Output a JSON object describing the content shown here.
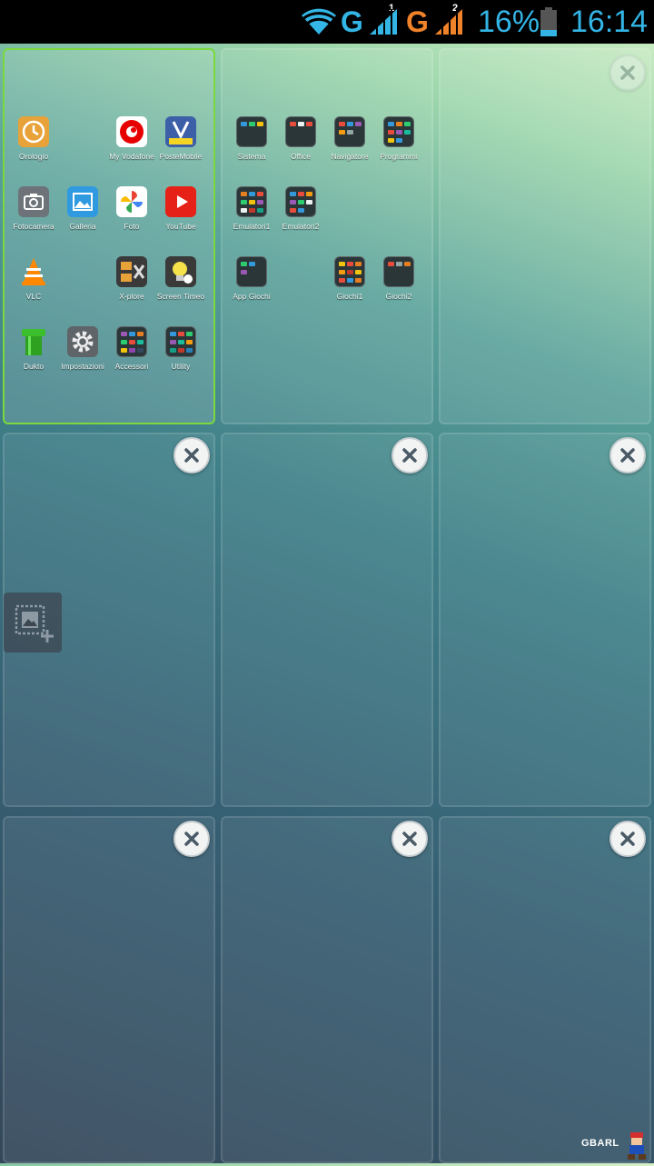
{
  "status_bar": {
    "network_1": "G",
    "sim_1": "1",
    "network_2": "G",
    "sim_2": "2",
    "battery": "16%",
    "time": "16:14",
    "colors": {
      "accent": "#33b5e5",
      "signal_2": "#f0822a",
      "background": "#000000"
    },
    "icons": [
      "wifi-icon",
      "signal-icon",
      "signal-icon",
      "battery-icon"
    ]
  },
  "screens": {
    "screen_1": {
      "active": true,
      "apps": [
        {
          "label": "Orologio",
          "icon": "clock-icon"
        },
        {
          "label": "My Vodafone",
          "icon": "vodafone-icon"
        },
        {
          "label": "PosteMobile",
          "icon": "postemobile-icon"
        },
        {
          "label": "Fotocamera",
          "icon": "camera-icon"
        },
        {
          "label": "Galleria",
          "icon": "gallery-icon"
        },
        {
          "label": "Foto",
          "icon": "photos-icon"
        },
        {
          "label": "YouTube",
          "icon": "youtube-icon"
        },
        {
          "label": "VLC",
          "icon": "vlc-icon"
        },
        {
          "label": "X-plore",
          "icon": "xplore-icon"
        },
        {
          "label": "Screen Timeo",
          "icon": "bulb-icon"
        },
        {
          "label": "Dukto",
          "icon": "dukto-icon"
        },
        {
          "label": "Impostazioni",
          "icon": "gear-icon"
        },
        {
          "label": "Accessori",
          "icon": "folder-icon"
        },
        {
          "label": "Utility",
          "icon": "folder-icon"
        }
      ]
    },
    "screen_2": {
      "folders": [
        {
          "label": "Sistema"
        },
        {
          "label": "Office"
        },
        {
          "label": "Navigatore"
        },
        {
          "label": "Programmi"
        },
        {
          "label": "Emulatori1"
        },
        {
          "label": "Emulatori2"
        },
        {
          "label": "App Giochi"
        },
        {
          "label": "Giochi1"
        },
        {
          "label": "Giochi2"
        }
      ]
    }
  },
  "tools": {
    "add_wallpaper_icon": "crop-image-add-icon",
    "close_icon": "close-icon"
  },
  "watermark": "GBARL"
}
